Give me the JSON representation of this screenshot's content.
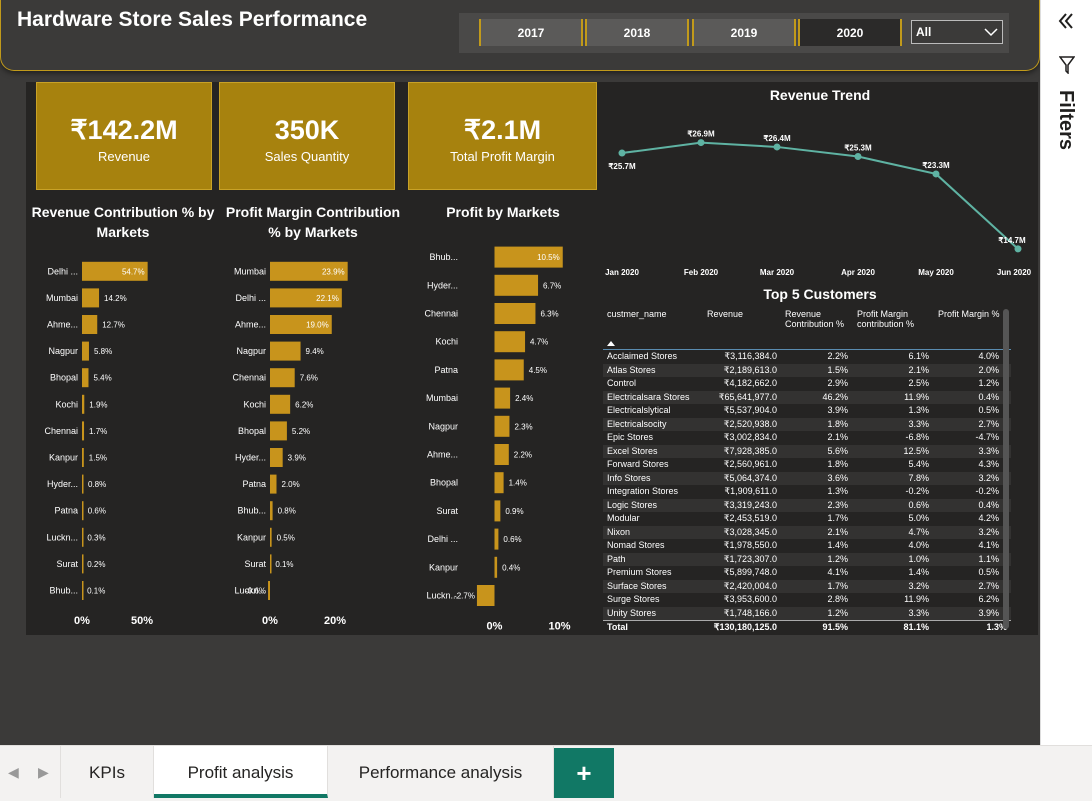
{
  "header": {
    "title": "Hardware Store Sales Performance",
    "years": [
      "2017",
      "2018",
      "2019",
      "2020"
    ],
    "selected_year": "2020",
    "dropdown_value": "All"
  },
  "kpis": [
    {
      "value": "₹142.2M",
      "label": "Revenue"
    },
    {
      "value": "350K",
      "label": "Sales Quantity"
    },
    {
      "value": "₹2.1M",
      "label": "Total Profit Margin"
    }
  ],
  "filters_label": "Filters",
  "chart_data": [
    {
      "type": "bar",
      "orientation": "horizontal",
      "title": "Revenue Contribution % by Markets",
      "categories": [
        "Delhi ...",
        "Mumbai",
        "Ahme...",
        "Nagpur",
        "Bhopal",
        "Kochi",
        "Chennai",
        "Kanpur",
        "Hyder...",
        "Patna",
        "Luckn...",
        "Surat",
        "Bhub..."
      ],
      "values": [
        54.7,
        14.2,
        12.7,
        5.8,
        5.4,
        1.9,
        1.7,
        1.5,
        0.8,
        0.6,
        0.3,
        0.2,
        0.1
      ],
      "labels": [
        "54.7%",
        "14.2%",
        "12.7%",
        "5.8%",
        "5.4%",
        "1.9%",
        "1.7%",
        "1.5%",
        "0.8%",
        "0.6%",
        "0.3%",
        "0.2%",
        "0.1%"
      ],
      "xticks": [
        "0%",
        "50%"
      ],
      "xlim": [
        0,
        100
      ]
    },
    {
      "type": "bar",
      "orientation": "horizontal",
      "title": "Profit Margin Contribution % by Markets",
      "categories": [
        "Mumbai",
        "Delhi ...",
        "Ahme...",
        "Nagpur",
        "Chennai",
        "Kochi",
        "Bhopal",
        "Hyder...",
        "Patna",
        "Bhub...",
        "Kanpur",
        "Surat",
        "Luckn..."
      ],
      "values": [
        23.9,
        22.1,
        19.0,
        9.4,
        7.6,
        6.2,
        5.2,
        3.9,
        2.0,
        0.8,
        0.5,
        0.1,
        -0.6
      ],
      "labels": [
        "23.9%",
        "22.1%",
        "19.0%",
        "9.4%",
        "7.6%",
        "6.2%",
        "5.2%",
        "3.9%",
        "2.0%",
        "0.8%",
        "0.5%",
        "0.1%",
        "-0.6%"
      ],
      "xticks": [
        "0%",
        "20%"
      ],
      "xlim": [
        0,
        40
      ]
    },
    {
      "type": "bar",
      "orientation": "horizontal",
      "title": "Profit by Markets",
      "categories": [
        "Bhub...",
        "Hyder...",
        "Chennai",
        "Kochi",
        "Patna",
        "Mumbai",
        "Nagpur",
        "Ahme...",
        "Bhopal",
        "Surat",
        "Delhi ...",
        "Kanpur",
        "Luckn..."
      ],
      "values": [
        10.5,
        6.7,
        6.3,
        4.7,
        4.5,
        2.4,
        2.3,
        2.2,
        1.4,
        0.9,
        0.6,
        0.4,
        -2.7
      ],
      "labels": [
        "10.5%",
        "6.7%",
        "6.3%",
        "4.7%",
        "4.5%",
        "2.4%",
        "2.3%",
        "2.2%",
        "1.4%",
        "0.9%",
        "0.6%",
        "0.4%",
        "-2.7%"
      ],
      "xticks": [
        "0%",
        "10%"
      ],
      "xlim": [
        -5,
        15
      ]
    },
    {
      "type": "line",
      "title": "Revenue Trend",
      "x": [
        "Jan 2020",
        "Feb 2020",
        "Mar 2020",
        "Apr 2020",
        "May 2020",
        "Jun 2020"
      ],
      "values": [
        25.7,
        26.9,
        26.4,
        25.3,
        23.3,
        14.7
      ],
      "labels": [
        "₹25.7M",
        "₹26.9M",
        "₹26.4M",
        "₹25.3M",
        "₹23.3M",
        "₹14.7M"
      ],
      "ylim": [
        14,
        28
      ]
    }
  ],
  "table": {
    "title": "Top 5 Customers",
    "columns": [
      "custmer_name",
      "Revenue",
      "Revenue Contribution %",
      "Profit Margin contribution %",
      "Profit Margin %"
    ],
    "rows": [
      [
        "Acclaimed Stores",
        "₹3,116,384.0",
        "2.2%",
        "6.1%",
        "4.0%"
      ],
      [
        "Atlas Stores",
        "₹2,189,613.0",
        "1.5%",
        "2.1%",
        "2.0%"
      ],
      [
        "Control",
        "₹4,182,662.0",
        "2.9%",
        "2.5%",
        "1.2%"
      ],
      [
        "Electricalsara Stores",
        "₹65,641,977.0",
        "46.2%",
        "11.9%",
        "0.4%"
      ],
      [
        "Electricalslytical",
        "₹5,537,904.0",
        "3.9%",
        "1.3%",
        "0.5%"
      ],
      [
        "Electricalsocity",
        "₹2,520,938.0",
        "1.8%",
        "3.3%",
        "2.7%"
      ],
      [
        "Epic Stores",
        "₹3,002,834.0",
        "2.1%",
        "-6.8%",
        "-4.7%"
      ],
      [
        "Excel Stores",
        "₹7,928,385.0",
        "5.6%",
        "12.5%",
        "3.3%"
      ],
      [
        "Forward Stores",
        "₹2,560,961.0",
        "1.8%",
        "5.4%",
        "4.3%"
      ],
      [
        "Info Stores",
        "₹5,064,374.0",
        "3.6%",
        "7.8%",
        "3.2%"
      ],
      [
        "Integration Stores",
        "₹1,909,611.0",
        "1.3%",
        "-0.2%",
        "-0.2%"
      ],
      [
        "Logic Stores",
        "₹3,319,243.0",
        "2.3%",
        "0.6%",
        "0.4%"
      ],
      [
        "Modular",
        "₹2,453,519.0",
        "1.7%",
        "5.0%",
        "4.2%"
      ],
      [
        "Nixon",
        "₹3,028,345.0",
        "2.1%",
        "4.7%",
        "3.2%"
      ],
      [
        "Nomad Stores",
        "₹1,978,550.0",
        "1.4%",
        "4.0%",
        "4.1%"
      ],
      [
        "Path",
        "₹1,723,307.0",
        "1.2%",
        "1.0%",
        "1.1%"
      ],
      [
        "Premium Stores",
        "₹5,899,748.0",
        "4.1%",
        "1.4%",
        "0.5%"
      ],
      [
        "Surface Stores",
        "₹2,420,004.0",
        "1.7%",
        "3.2%",
        "2.7%"
      ],
      [
        "Surge Stores",
        "₹3,953,600.0",
        "2.8%",
        "11.9%",
        "6.2%"
      ],
      [
        "Unity Stores",
        "₹1,748,166.0",
        "1.2%",
        "3.3%",
        "3.9%"
      ]
    ],
    "total": [
      "Total",
      "₹130,180,125.0",
      "91.5%",
      "81.1%",
      "1.3%"
    ]
  },
  "tabs": [
    {
      "label": "KPIs"
    },
    {
      "label": "Profit analysis",
      "active": true
    },
    {
      "label": "Performance analysis"
    }
  ],
  "add_tab_label": "+",
  "colors": {
    "accent": "#c19a1b",
    "bar": "#c8941c",
    "line": "#5fb3a3",
    "tab_active": "#117865"
  }
}
